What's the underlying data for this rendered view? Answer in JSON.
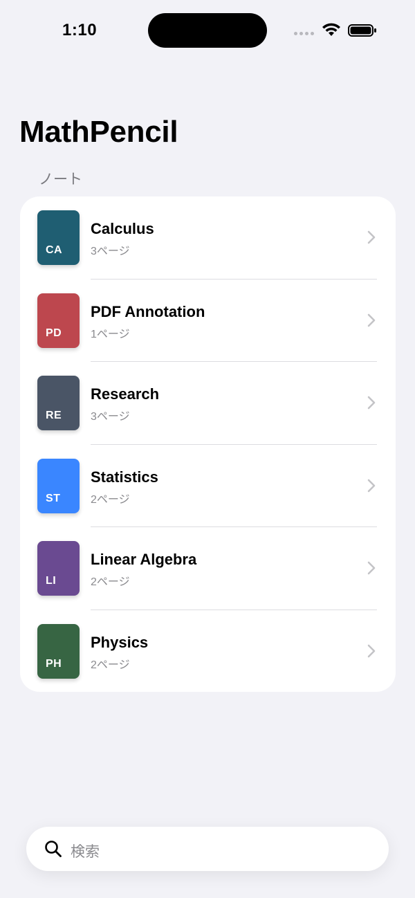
{
  "status_bar": {
    "time": "1:10",
    "icons": [
      "cellular-signal-icon",
      "wifi-icon",
      "battery-icon"
    ]
  },
  "header": {
    "title": "MathPencil",
    "section_label": "ノート"
  },
  "notes": [
    {
      "title": "Calculus",
      "subtitle": "3ページ",
      "abbr": "CA",
      "color": "#1f5e72"
    },
    {
      "title": "PDF Annotation",
      "subtitle": "1ページ",
      "abbr": "PD",
      "color": "#bd474e"
    },
    {
      "title": "Research",
      "subtitle": "3ページ",
      "abbr": "RE",
      "color": "#4a5566"
    },
    {
      "title": "Statistics",
      "subtitle": "2ページ",
      "abbr": "ST",
      "color": "#3a86ff"
    },
    {
      "title": "Linear Algebra",
      "subtitle": "2ページ",
      "abbr": "LI",
      "color": "#6a4a91"
    },
    {
      "title": "Physics",
      "subtitle": "2ページ",
      "abbr": "PH",
      "color": "#376543"
    }
  ],
  "search": {
    "placeholder": "検索"
  },
  "colors": {
    "background": "#f2f2f7",
    "card": "#ffffff",
    "secondary_text": "#8a8a8e",
    "chevron": "#c4c4c7"
  }
}
